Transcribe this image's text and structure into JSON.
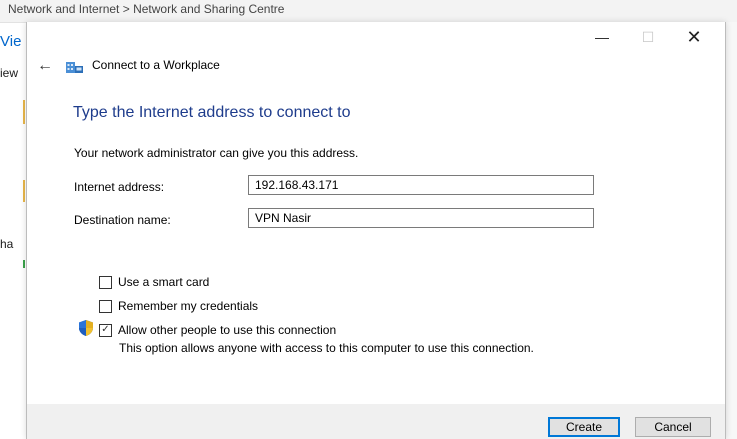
{
  "background": {
    "breadcrumb": "Network and Internet  >  Network and Sharing Centre",
    "fragments": {
      "vie": "Vie",
      "iew": "iew",
      "ha": "ha"
    }
  },
  "dialog": {
    "title": "Connect to a Workplace",
    "window_controls": {
      "minimize": "—",
      "maximize": "☐",
      "close": "✕"
    },
    "back_glyph": "←",
    "heading": "Type the Internet address to connect to",
    "description": "Your network administrator can give you this address.",
    "fields": {
      "internet_address_label": "Internet address:",
      "internet_address_value": "192.168.43.171",
      "destination_name_label": "Destination name:",
      "destination_name_value": "VPN Nasir"
    },
    "options": {
      "smart_card": {
        "label": "Use a smart card",
        "checked": false
      },
      "remember_credentials": {
        "label": "Remember my credentials",
        "checked": false
      },
      "allow_others": {
        "label": "Allow other people to use this connection",
        "checked": true,
        "check_glyph": "✓"
      },
      "allow_others_note": "This option allows anyone with access to this computer to use this connection."
    },
    "buttons": {
      "create": "Create",
      "cancel": "Cancel"
    },
    "icons": {
      "app": "network-connection-icon",
      "shield": "uac-shield-icon"
    },
    "colors": {
      "heading": "#1e3c8c",
      "accent": "#0078d7"
    }
  }
}
